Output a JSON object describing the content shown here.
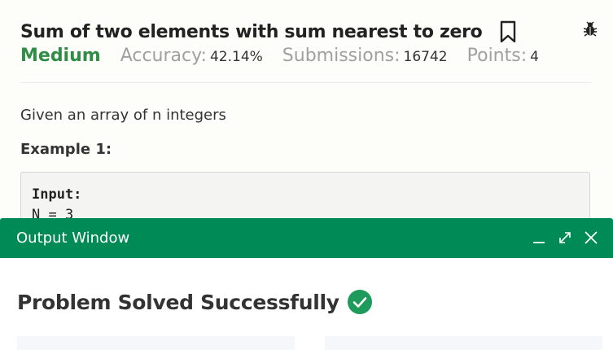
{
  "problem": {
    "title": "Sum of two elements with sum nearest to zero",
    "difficulty": "Medium",
    "accuracy_label": "Accuracy:",
    "accuracy_value": "42.14%",
    "submissions_label": "Submissions:",
    "submissions_value": "16742",
    "points_label": "Points:",
    "points_value": "4",
    "description": "Given an array of n integers",
    "example_title": "Example 1:",
    "code_lines": [
      "Input:",
      "N = 3"
    ]
  },
  "output_window": {
    "title": "Output Window",
    "result": "Problem Solved Successfully"
  },
  "colors": {
    "accent_green": "#2f8d46",
    "header_green": "#008a55",
    "success_green": "#1e9a5a"
  },
  "icons": {
    "bookmark": "bookmark-icon",
    "bug": "bug-icon",
    "minimize": "minimize-icon",
    "maximize": "maximize-icon",
    "close": "close-icon",
    "check": "check-circle-icon"
  }
}
